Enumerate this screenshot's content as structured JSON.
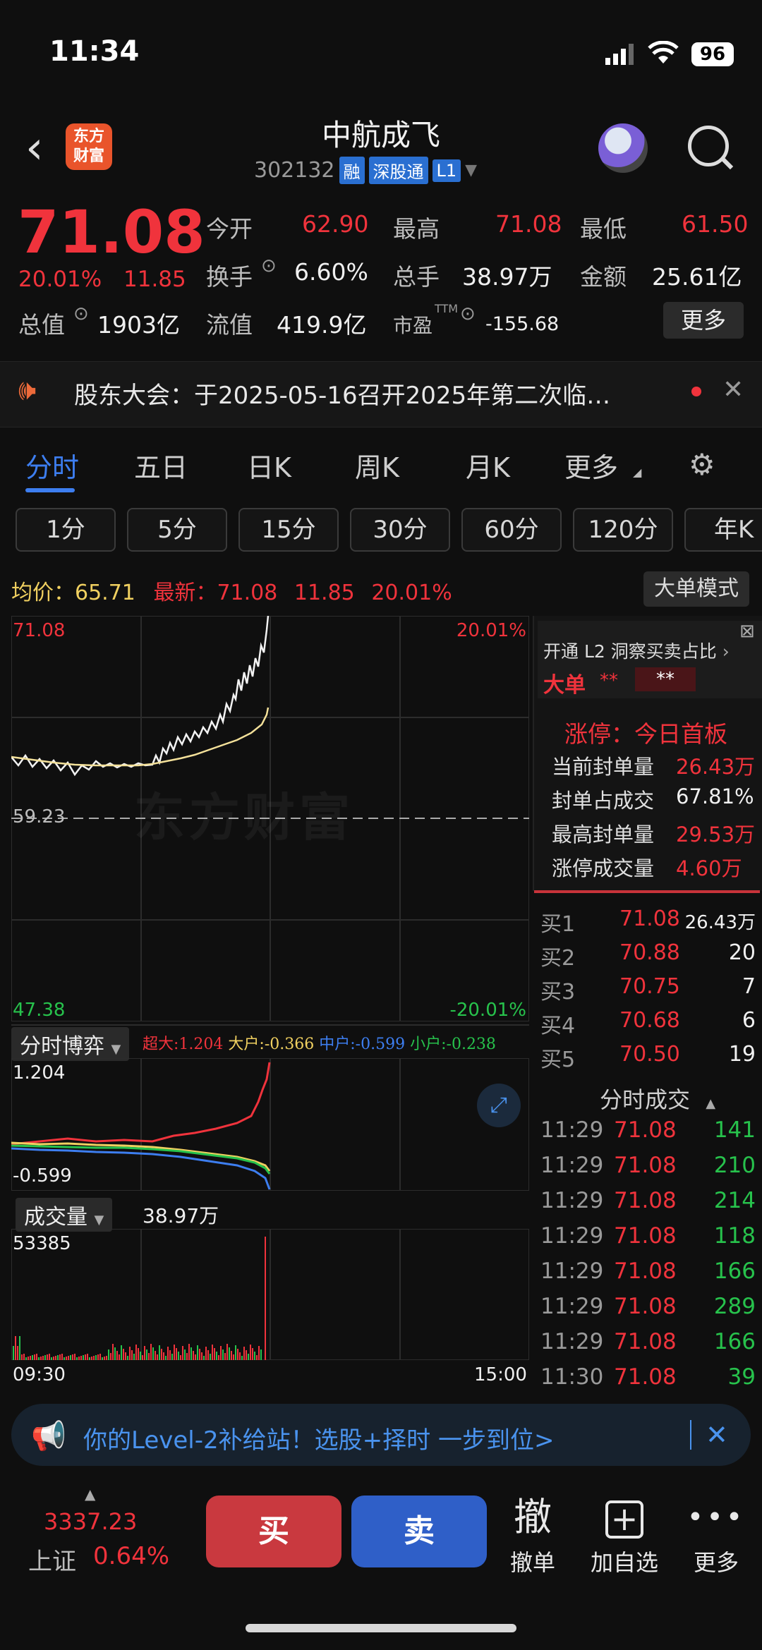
{
  "status": {
    "time": "11:34",
    "battery": "96"
  },
  "header": {
    "logo_text": "东方\n财富",
    "title": "中航成飞",
    "code": "302132",
    "tags": [
      "融",
      "深股通",
      "L1"
    ]
  },
  "quote": {
    "price": "71.08",
    "change_pct": "20.01%",
    "change_amt": "11.85",
    "fields": [
      {
        "label": "今开",
        "value": "62.90"
      },
      {
        "label": "最高",
        "value": "71.08"
      },
      {
        "label": "最低",
        "value": "61.50"
      },
      {
        "label": "换手",
        "value": "6.60%"
      },
      {
        "label": "总手",
        "value": "38.97万"
      },
      {
        "label": "金额",
        "value": "25.61亿"
      },
      {
        "label": "总值",
        "value": "1903亿"
      },
      {
        "label": "流值",
        "value": "419.9亿"
      },
      {
        "label": "市盈",
        "sup": "TTM",
        "value": "-155.68"
      }
    ],
    "more_label": "更多"
  },
  "notice": {
    "text": "股东大会：于2025-05-16召开2025年第二次临…"
  },
  "tabs": [
    "分时",
    "五日",
    "日K",
    "周K",
    "月K",
    "更多"
  ],
  "periods": [
    "1分",
    "5分",
    "15分",
    "30分",
    "60分",
    "120分",
    "年K"
  ],
  "info": {
    "avg_label": "均价：",
    "avg_value": "65.71",
    "latest_label": "最新：",
    "latest_price": "71.08",
    "latest_chg": "11.85",
    "latest_pct": "20.01%",
    "mode_button": "大单模式"
  },
  "chart": {
    "y_top": "71.08",
    "y_mid": "59.23",
    "y_bot": "47.38",
    "pct_top": "20.01%",
    "pct_bot": "-20.01%",
    "watermark": "东方财富",
    "x_start": "09:30",
    "x_end": "15:00"
  },
  "bobo": {
    "label": "分时博弈",
    "legend": [
      {
        "name": "超大:",
        "value": "1.204",
        "color": "#f0333c"
      },
      {
        "name": "大户:",
        "value": "-0.366",
        "color": "#f0d060"
      },
      {
        "name": "中户:",
        "value": "-0.599",
        "color": "#3d7ef0"
      },
      {
        "name": "小户:",
        "value": "-0.238",
        "color": "#27c24c"
      }
    ],
    "y_top": "1.204",
    "y_bot": "-0.599"
  },
  "volume": {
    "label": "成交量",
    "total": "38.97万",
    "y_top": "53385"
  },
  "right_panel": {
    "l2_title": "开通 L2 洞察买卖占比",
    "big_label": "大单",
    "big_v1": "**",
    "big_v2": "**",
    "limit_title": "涨停：今日首板",
    "limit_rows": [
      {
        "label": "当前封单量",
        "value": "26.43万"
      },
      {
        "label": "封单占成交",
        "value": "67.81%"
      },
      {
        "label": "最高封单量",
        "value": "29.53万"
      },
      {
        "label": "涨停成交量",
        "value": "4.60万"
      }
    ],
    "orderbook": [
      {
        "label": "买1",
        "price": "71.08",
        "vol": "26.43万"
      },
      {
        "label": "买2",
        "price": "70.88",
        "vol": "20"
      },
      {
        "label": "买3",
        "price": "70.75",
        "vol": "7"
      },
      {
        "label": "买4",
        "price": "70.68",
        "vol": "6"
      },
      {
        "label": "买5",
        "price": "70.50",
        "vol": "19"
      }
    ],
    "trades_title": "分时成交",
    "trades": [
      {
        "time": "11:29",
        "price": "71.08",
        "vol": "141"
      },
      {
        "time": "11:29",
        "price": "71.08",
        "vol": "210"
      },
      {
        "time": "11:29",
        "price": "71.08",
        "vol": "214"
      },
      {
        "time": "11:29",
        "price": "71.08",
        "vol": "118"
      },
      {
        "time": "11:29",
        "price": "71.08",
        "vol": "166"
      },
      {
        "time": "11:29",
        "price": "71.08",
        "vol": "289"
      },
      {
        "time": "11:29",
        "price": "71.08",
        "vol": "166"
      },
      {
        "time": "11:30",
        "price": "71.08",
        "vol": "39"
      }
    ]
  },
  "banner": {
    "text": "你的Level-2补给站！选股+择时 一步到位>"
  },
  "bottombar": {
    "index_value": "3337.23",
    "index_name": "上证",
    "index_pct": "0.64%",
    "buy": "买",
    "sell": "卖",
    "items": [
      {
        "icon": "撤",
        "label": "撤单"
      },
      {
        "icon": "+",
        "label": "加自选"
      },
      {
        "icon": "•••",
        "label": "更多"
      }
    ]
  }
}
